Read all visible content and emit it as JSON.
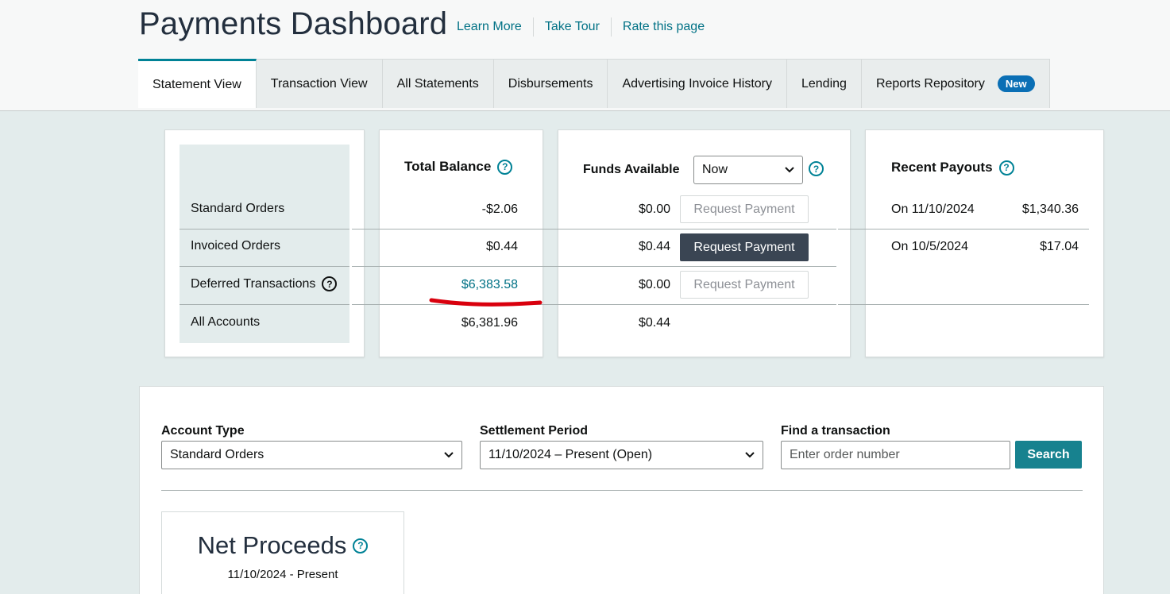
{
  "header": {
    "title": "Payments Dashboard",
    "links": [
      "Learn More",
      "Take Tour",
      "Rate this page"
    ]
  },
  "tabs": [
    {
      "label": "Statement View",
      "active": true
    },
    {
      "label": "Transaction View"
    },
    {
      "label": "All Statements"
    },
    {
      "label": "Disbursements"
    },
    {
      "label": "Advertising Invoice History"
    },
    {
      "label": "Lending"
    },
    {
      "label": "Reports Repository",
      "badge": "New"
    }
  ],
  "rows": {
    "standard_orders": "Standard Orders",
    "invoiced_orders": "Invoiced Orders",
    "deferred_transactions": "Deferred Transactions",
    "all_accounts": "All Accounts"
  },
  "total_balance": {
    "title": "Total Balance",
    "values": [
      "-$2.06",
      "$0.44",
      "$6,383.58",
      "$6,381.96"
    ]
  },
  "funds_available": {
    "title": "Funds Available",
    "selected": "Now",
    "values": [
      "$0.00",
      "$0.44",
      "$0.00",
      "$0.44"
    ],
    "request_payment_label": "Request Payment"
  },
  "recent_payouts": {
    "title": "Recent Payouts",
    "items": [
      {
        "date": "On 11/10/2024",
        "amount": "$1,340.36"
      },
      {
        "date": "On 10/5/2024",
        "amount": "$17.04"
      }
    ]
  },
  "filters": {
    "account_type_label": "Account Type",
    "account_type_value": "Standard Orders",
    "settlement_period_label": "Settlement Period",
    "settlement_period_value": "11/10/2024 – Present (Open)",
    "find_label": "Find a transaction",
    "find_placeholder": "Enter order number",
    "search_label": "Search"
  },
  "net_proceeds": {
    "title": "Net Proceeds",
    "date": "11/10/2024 - Present"
  },
  "colors": {
    "accent": "#008296",
    "link": "#007185",
    "annotation": "#d9000d",
    "badge": "#0a6fb5"
  }
}
